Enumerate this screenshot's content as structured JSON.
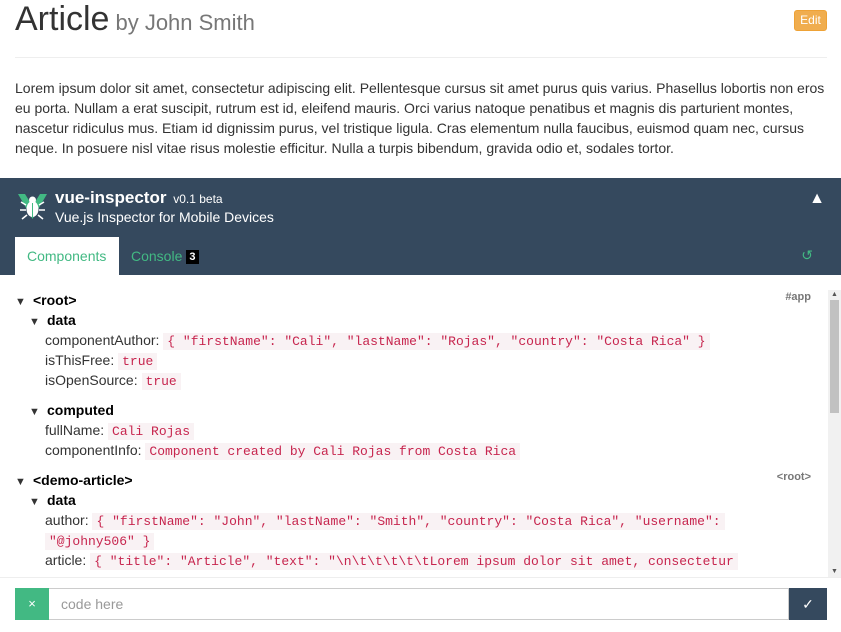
{
  "article": {
    "title": "Article",
    "author": "by John Smith",
    "edit_label": "Edit",
    "text": "Lorem ipsum dolor sit amet, consectetur adipiscing elit. Pellentesque cursus sit amet purus quis varius. Phasellus lobortis non eros eu porta. Nullam a erat suscipit, rutrum est id, eleifend mauris. Orci varius natoque penatibus et magnis dis parturient montes, nascetur ridiculus mus. Etiam id dignissim purus, vel tristique ligula. Cras elementum nulla faucibus, euismod quam nec, cursus neque. In posuere nisl vitae risus molestie efficitur. Nulla a turpis bibendum, gravida odio et, sodales tortor."
  },
  "inspector": {
    "title": "vue-inspector",
    "version": "v0.1 beta",
    "subtitle": "Vue.js Inspector for Mobile Devices",
    "collapse_icon": "▲",
    "refresh_icon": "↺",
    "tabs": [
      {
        "label": "Components"
      },
      {
        "label": "Console",
        "badge": "3"
      }
    ]
  },
  "tree": {
    "root": {
      "label": "<root>",
      "ref": "#app",
      "data_label": "data",
      "data": [
        {
          "key": "componentAuthor:",
          "value": "{ \"firstName\": \"Cali\", \"lastName\": \"Rojas\", \"country\": \"Costa Rica\" }"
        },
        {
          "key": "isThisFree:",
          "value": "true"
        },
        {
          "key": "isOpenSource:",
          "value": "true"
        }
      ],
      "computed_label": "computed",
      "computed": [
        {
          "key": "fullName:",
          "value": "Cali Rojas"
        },
        {
          "key": "componentInfo:",
          "value": "Component created by Cali Rojas from Costa Rica"
        }
      ]
    },
    "demo": {
      "label": "<demo-article>",
      "ref": "<root>",
      "data_label": "data",
      "author_key": "author:",
      "author_value_1": "{ \"firstName\": \"John\", \"lastName\": \"Smith\", \"country\": \"Costa Rica\", \"username\":",
      "author_value_2": "\"@johny506\" }",
      "article_key": "article:",
      "article_value": "{ \"title\": \"Article\", \"text\": \"\\n\\t\\t\\t\\t\\tLorem ipsum dolor sit amet, consectetur"
    }
  },
  "console": {
    "clear_icon": "×",
    "placeholder": "code here",
    "run_icon": "✓"
  },
  "colors": {
    "header_bg": "#35495e",
    "accent": "#42b983",
    "edit_button": "#f0ad4e",
    "value_text": "#c7254e"
  }
}
